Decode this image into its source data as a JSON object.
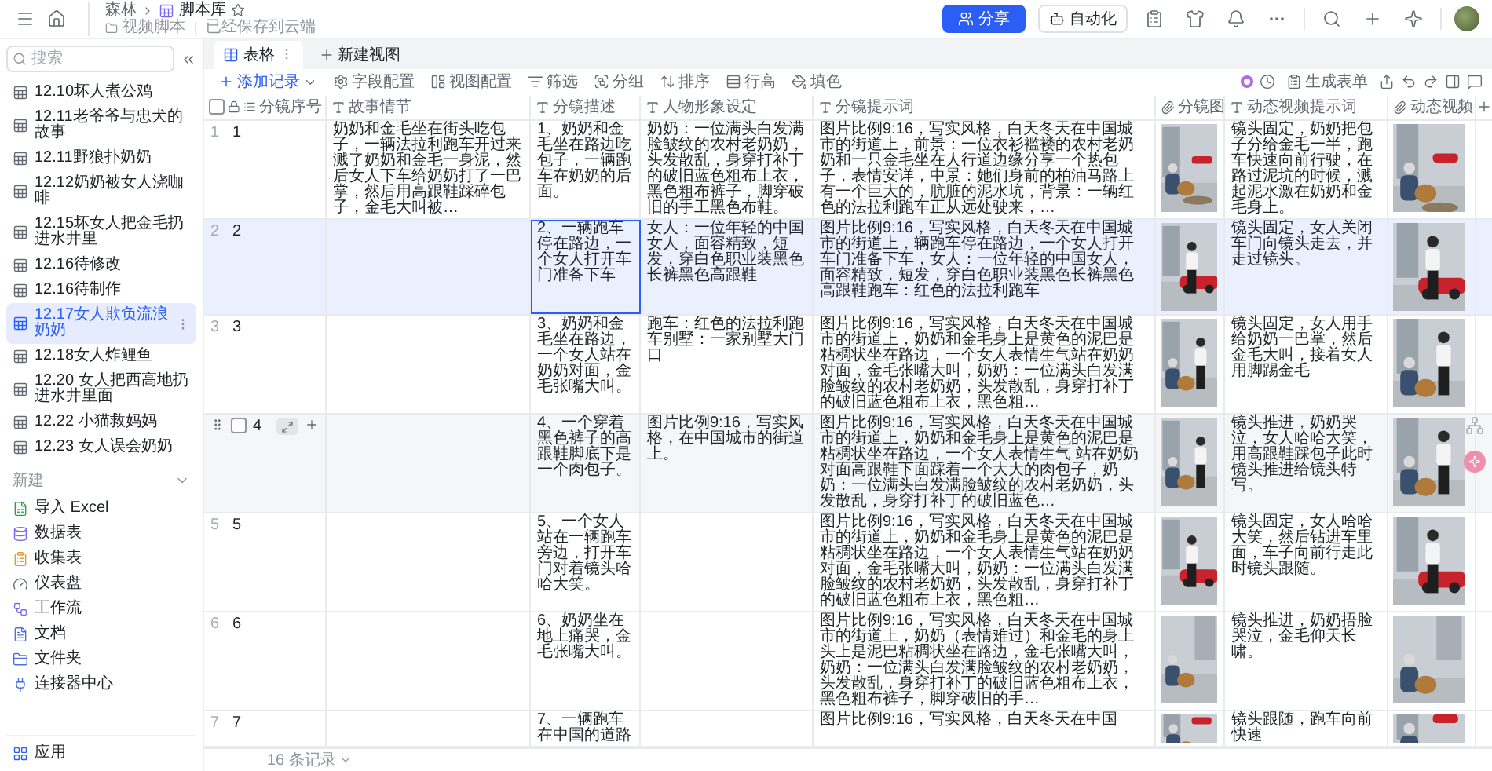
{
  "topbar": {
    "breadcrumb": [
      "森林",
      "脚本库"
    ],
    "folder": "视频脚本",
    "save_status": "已经保存到云端",
    "share_button": "分享",
    "automation_button": "自动化"
  },
  "sidebar": {
    "search": {
      "placeholder": "搜索"
    },
    "items": [
      {
        "label": "12.10坏人煮公鸡",
        "selected": false
      },
      {
        "label": "12.11老爷爷与忠犬的故事",
        "selected": false
      },
      {
        "label": "12.11野狼扑奶奶",
        "selected": false
      },
      {
        "label": "12.12奶奶被女人浇咖啡",
        "selected": false
      },
      {
        "label": "12.15坏女人把金毛扔进水井里",
        "selected": false
      },
      {
        "label": "12.16待修改",
        "selected": false
      },
      {
        "label": "12.16待制作",
        "selected": false
      },
      {
        "label": "12.17女人欺负流浪奶奶",
        "selected": true
      },
      {
        "label": "12.18女人炸鲤鱼",
        "selected": false
      },
      {
        "label": "12.20 女人把西高地扔进水井里面",
        "selected": false
      },
      {
        "label": "12.22 小猫救妈妈",
        "selected": false
      },
      {
        "label": "12.23 女人误会奶奶",
        "selected": false
      }
    ],
    "new_section": {
      "title": "新建",
      "expanded": true,
      "items": [
        {
          "label": "导入 Excel",
          "kind": "excel"
        },
        {
          "label": "数据表",
          "kind": "datasheet"
        },
        {
          "label": "收集表",
          "kind": "form"
        },
        {
          "label": "仪表盘",
          "kind": "dashboard"
        },
        {
          "label": "工作流",
          "kind": "workflow"
        },
        {
          "label": "文档",
          "kind": "doc"
        },
        {
          "label": "文件夹",
          "kind": "folder"
        },
        {
          "label": "连接器中心",
          "kind": "connector"
        }
      ]
    },
    "apps": "应用"
  },
  "views": {
    "tabs": [
      {
        "label": "表格",
        "selected": true
      }
    ],
    "new_view": "新建视图"
  },
  "toolbar": {
    "add_record": "添加记录",
    "tools": [
      {
        "label": "字段配置",
        "kind": "fields"
      },
      {
        "label": "视图配置",
        "kind": "view"
      },
      {
        "label": "筛选",
        "kind": "filter"
      },
      {
        "label": "分组",
        "kind": "group"
      },
      {
        "label": "排序",
        "kind": "sort"
      },
      {
        "label": "行高",
        "kind": "row_height"
      },
      {
        "label": "填色",
        "kind": "fill"
      }
    ],
    "generate_form": "生成表单"
  },
  "table": {
    "all_selected": false,
    "columns": [
      {
        "label": "分镜序号",
        "kind": "seq"
      },
      {
        "label": "故事情节",
        "kind": "text"
      },
      {
        "label": "分镜描述",
        "kind": "text"
      },
      {
        "label": "人物形象设定",
        "kind": "text"
      },
      {
        "label": "分镜提示词",
        "kind": "text"
      },
      {
        "label": "分镜图",
        "kind": "attachment"
      },
      {
        "label": "动态视频提示词",
        "kind": "text"
      },
      {
        "label": "动态视频",
        "kind": "attachment"
      }
    ],
    "rows": [
      {
        "index": "1",
        "seq": "1",
        "selected": false,
        "hovered": false,
        "description_focused": false,
        "story": "奶奶和金毛坐在街头吃包子，一辆法拉利跑车开过来溅了奶奶和金毛一身泥，然后女人下车给奶奶打了一巴掌，然后用高跟鞋踩碎包子，金毛大叫被…",
        "description": "1、奶奶和金毛坐在路边吃包子，一辆跑车在奶奶的后面。",
        "character": "奶奶：一位满头白发满脸皱纹的农村老奶奶，头发散乱，身穿打补丁的破旧蓝色粗布上衣，黑色粗布裤子，脚穿破旧的手工黑色布鞋。",
        "prompt": "图片比例9:16，写实风格，白天冬天在中国城市的街道上，前景：一位衣衫褴褛的农村老奶奶和一只金毛坐在人行道边缘分享一个热包子，表情安详，中景：她们身前的柏油马路上有一个巨大的，肮脏的泥水坑，背景：一辆红色的法拉利跑车正从远处驶来，…",
        "video_prompt": "镜头固定，奶奶把包子分给金毛一半，跑车快速向前行驶，在路过泥坑的时候，溅起泥水激在奶奶和金毛身上。"
      },
      {
        "index": "2",
        "seq": "2",
        "selected": true,
        "hovered": false,
        "description_focused": true,
        "description": "2、一辆跑车停在路边，一个女人打开车门准备下车",
        "character": "女人：一位年轻的中国女人，面容精致，短发，穿白色职业装黑色长裤黑色高跟鞋",
        "prompt": "图片比例9:16，写实风格，白天冬天在中国城市的街道上，辆跑车停在路边，一个女人打开车门准备下车，女人：一位年轻的中国女人，面容精致，短发，穿白色职业装黑色长裤黑色高跟鞋跑车：红色的法拉利跑车",
        "video_prompt": "镜头固定，女人关闭车门向镜头走去，并走过镜头。"
      },
      {
        "index": "3",
        "seq": "3",
        "selected": false,
        "hovered": false,
        "description_focused": false,
        "description": "3、奶奶和金毛坐在路边，一个女人站在奶奶对面，金毛张嘴大叫。",
        "character": "跑车：红色的法拉利跑车别墅：一家别墅大门口",
        "prompt": "图片比例9:16，写实风格，白天冬天在中国城市的街道上，奶奶和金毛身上是黄色的泥巴是粘稠状坐在路边，一个女人表情生气站在奶奶对面，金毛张嘴大叫，奶奶：一位满头白发满脸皱纹的农村老奶奶，头发散乱，身穿打补丁的破旧蓝色粗布上衣，黑色粗…",
        "video_prompt": "镜头固定，女人用手给奶奶一巴掌，然后金毛大叫，接着女人用脚踢金毛"
      },
      {
        "seq": "4",
        "selected": false,
        "hovered": true,
        "description_focused": false,
        "description": "4、一个穿着黑色裤子的高跟鞋脚底下是一个肉包子。",
        "character": "图片比例9:16，写实风格，在中国城市的街道上。",
        "prompt": "图片比例9:16，写实风格，白天冬天在中国城市的街道上，奶奶和金毛身上是黄色的泥巴是粘稠状坐在路边，一个女人表情生气 站在奶奶对面高跟鞋下面踩着一个大大的肉包子，奶奶：一位满头白发满脸皱纹的农村老奶奶，头发散乱，身穿打补丁的破旧蓝色…",
        "video_prompt": "镜头推进，奶奶哭泣，女人哈哈大笑，用高跟鞋踩包子此时镜头推进给镜头特写。"
      },
      {
        "index": "5",
        "seq": "5",
        "selected": false,
        "hovered": false,
        "description_focused": false,
        "description": "5、一个女人站在一辆跑车旁边，打开车门对着镜头哈哈大笑。",
        "prompt": "图片比例9:16，写实风格，白天冬天在中国城市的街道上，奶奶和金毛身上是黄色的泥巴是粘稠状坐在路边，一个女人表情生气站在奶奶对面，金毛张嘴大叫，奶奶：一位满头白发满脸皱纹的农村老奶奶，头发散乱，身穿打补丁的破旧蓝色粗布上衣，黑色粗…",
        "video_prompt": "镜头固定，女人哈哈大笑，然后钻进车里面，车子向前行走此时镜头跟随。"
      },
      {
        "index": "6",
        "seq": "6",
        "selected": false,
        "hovered": false,
        "description_focused": false,
        "description": "6、奶奶坐在地上痛哭，金毛张嘴大叫。",
        "prompt": "图片比例9:16，写实风格，白天冬天在中国城市的街道上，奶奶（表情难过）和金毛的身上头上是泥巴粘稠状坐在路边，金毛张嘴大叫，奶奶：一位满头白发满脸皱纹的农村老奶奶，头发散乱，身穿打补丁的破旧蓝色粗布上衣，黑色粗布裤子，脚穿破旧的手…",
        "video_prompt": "镜头推进，奶奶捂脸哭泣，金毛仰天长啸。"
      },
      {
        "index": "7",
        "seq": "7",
        "selected": false,
        "hovered": false,
        "description_focused": false,
        "description": "7、一辆跑车在中国的道路",
        "prompt": "图片比例9:16，写实风格，白天冬天在中国",
        "video_prompt": "镜头跟随，跑车向前快速"
      }
    ],
    "record_count": "16 条记录"
  }
}
